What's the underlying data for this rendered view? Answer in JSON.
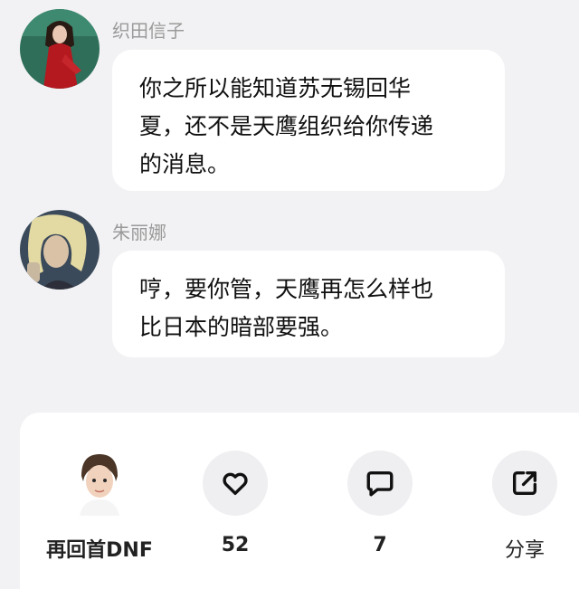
{
  "messages": [
    {
      "sender": "织田信子",
      "lines": [
        "你之所以能知道苏无锡回华",
        "夏，还不是天鹰组织给你传递",
        "的消息。"
      ]
    },
    {
      "sender": "朱丽娜",
      "lines": [
        "哼，要你管，天鹰再怎么样也",
        "比日本的暗部要强。"
      ]
    }
  ],
  "footer": {
    "username": "再回首DNF",
    "like_count": "52",
    "comment_count": "7",
    "share_label": "分享"
  },
  "icons": {
    "like": "heart-icon",
    "comment": "comment-icon",
    "share": "share-icon"
  },
  "colors": {
    "background": "#f2f2f4",
    "bubble": "#ffffff",
    "sender_name": "#9a9a9a"
  }
}
